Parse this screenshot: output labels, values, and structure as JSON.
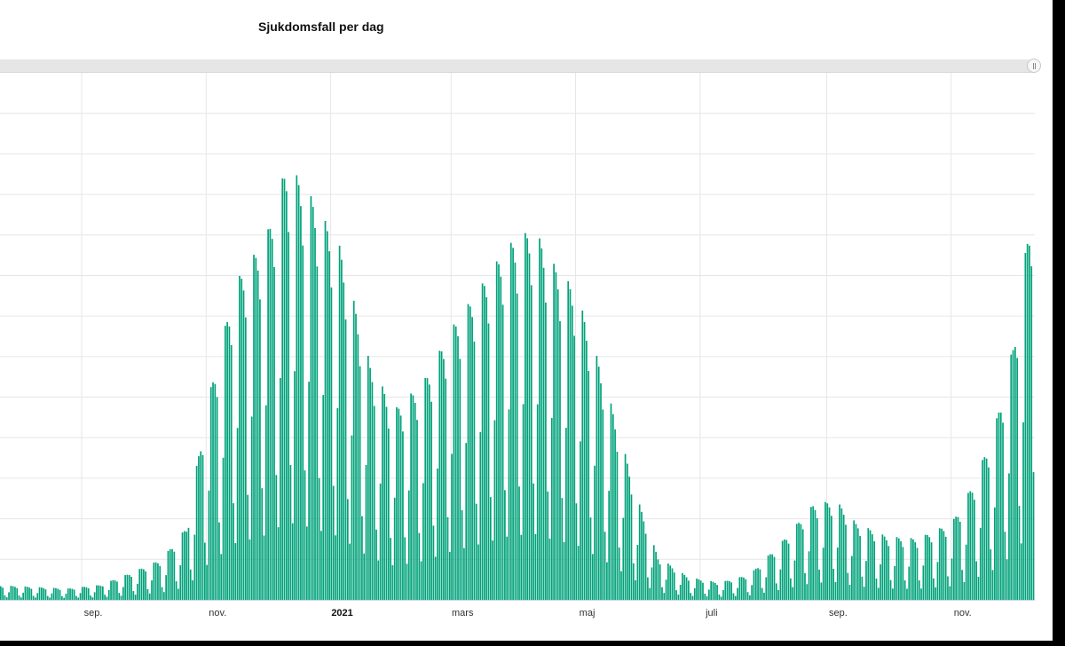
{
  "chart_data": {
    "type": "bar",
    "title": "Sjukdomsfall per dag",
    "color": "#00A27A",
    "x_start": "2020-07-23",
    "x_end": "2021-12-11",
    "ylim": [
      0,
      13000
    ],
    "grid": true,
    "x_ticks": [
      {
        "date": "2020-09-01",
        "label": "sep.",
        "bold": false
      },
      {
        "date": "2020-11-01",
        "label": "nov.",
        "bold": false
      },
      {
        "date": "2021-01-01",
        "label": "2021",
        "bold": true
      },
      {
        "date": "2021-03-01",
        "label": "mars",
        "bold": false
      },
      {
        "date": "2021-05-01",
        "label": "maj",
        "bold": false
      },
      {
        "date": "2021-07-01",
        "label": "juli",
        "bold": false
      },
      {
        "date": "2021-09-01",
        "label": "sep.",
        "bold": false
      },
      {
        "date": "2021-11-01",
        "label": "nov.",
        "bold": false
      }
    ],
    "y_gridlines": [
      1000,
      2000,
      3000,
      4000,
      5000,
      6000,
      7000,
      8000,
      9000,
      10000,
      11000,
      12000
    ],
    "weekly_profile": [
      0.6,
      1.12,
      1.1,
      1.05,
      0.95,
      0.35,
      0.2
    ],
    "weekly_profile_start": "2020-07-27",
    "anchors": [
      [
        "2020-07-23",
        320
      ],
      [
        "2020-08-10",
        280
      ],
      [
        "2020-08-25",
        250
      ],
      [
        "2020-09-10",
        330
      ],
      [
        "2020-09-25",
        600
      ],
      [
        "2020-10-10",
        900
      ],
      [
        "2020-10-22",
        1600
      ],
      [
        "2020-11-01",
        4300
      ],
      [
        "2020-11-15",
        7000
      ],
      [
        "2020-11-30",
        8000
      ],
      [
        "2020-12-10",
        9600
      ],
      [
        "2020-12-18",
        9200
      ],
      [
        "2021-01-05",
        7800
      ],
      [
        "2021-01-20",
        5200
      ],
      [
        "2021-02-01",
        4200
      ],
      [
        "2021-02-15",
        4800
      ],
      [
        "2021-03-01",
        6000
      ],
      [
        "2021-03-15",
        6900
      ],
      [
        "2021-03-28",
        7800
      ],
      [
        "2021-04-10",
        8200
      ],
      [
        "2021-04-20",
        7400
      ],
      [
        "2021-05-01",
        6800
      ],
      [
        "2021-05-15",
        4800
      ],
      [
        "2021-06-01",
        2100
      ],
      [
        "2021-06-10",
        950
      ],
      [
        "2021-06-25",
        500
      ],
      [
        "2021-07-10",
        380
      ],
      [
        "2021-07-25",
        560
      ],
      [
        "2021-08-10",
        1300
      ],
      [
        "2021-08-25",
        2100
      ],
      [
        "2021-09-05",
        2200
      ],
      [
        "2021-09-15",
        1700
      ],
      [
        "2021-09-30",
        1400
      ],
      [
        "2021-10-15",
        1350
      ],
      [
        "2021-11-01",
        1700
      ],
      [
        "2021-11-12",
        2600
      ],
      [
        "2021-11-22",
        3800
      ],
      [
        "2021-12-01",
        5600
      ],
      [
        "2021-12-11",
        9000
      ]
    ]
  }
}
